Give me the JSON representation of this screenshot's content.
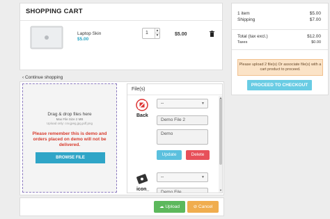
{
  "cart": {
    "title": "SHOPPING CART",
    "item": {
      "name": "Laptop Skin",
      "price": "$5.00",
      "quantity": "1",
      "line_total": "$5.00"
    }
  },
  "summary": {
    "items_label": "1 item",
    "items_value": "$5.00",
    "shipping_label": "Shipping",
    "shipping_value": "$7.00",
    "total_label": "Total (tax excl.)",
    "total_value": "$12.00",
    "taxes_label": "Taxes",
    "taxes_value": "$0.00",
    "alert": "Please upload 2 file(s) Or associate file(s) with a cart product to proceed.",
    "checkout_label": "PROCEED TO CHECKOUT"
  },
  "continue_label": "Continue shopping",
  "dropzone": {
    "title": "Drag & drop files here",
    "max_size": "Max File Size 2 MB",
    "allowed": "Upload only: csv,jpeg,jpg,pdf,png",
    "warning": "Please remember this is demo and orders placed on demo will not be delivered.",
    "browse_label": "BROWSE FILE"
  },
  "files": {
    "title": "File(s)",
    "items": [
      {
        "name": "Back",
        "select_value": "--",
        "name_value": "Demo File 2",
        "desc_value": "Demo",
        "update_label": "Update",
        "delete_label": "Delete"
      },
      {
        "name": "icon_",
        "select_value": "--",
        "name_value": "Demo File"
      }
    ]
  },
  "bottom": {
    "upload_label": "Upload",
    "cancel_label": "Cancel"
  },
  "colors": {
    "accent": "#2aa5c4",
    "warning": "#d73a2c",
    "upload": "#5cb85c",
    "cancel": "#f0ad4e",
    "delete": "#e7505a"
  }
}
